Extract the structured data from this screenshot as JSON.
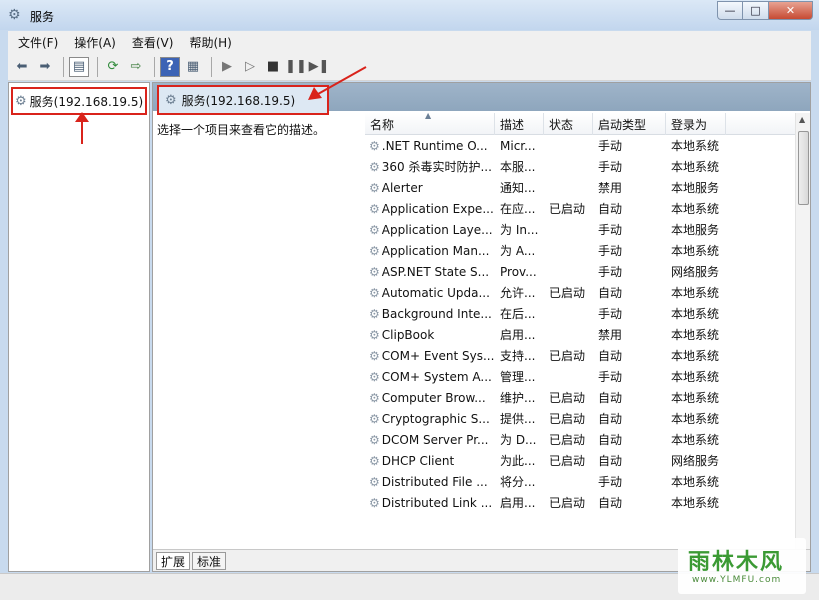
{
  "window": {
    "title": "服务",
    "controls": {
      "minimize": "—",
      "maximize": "□",
      "close": "✕"
    }
  },
  "menu": [
    "文件(F)",
    "操作(A)",
    "查看(V)",
    "帮助(H)"
  ],
  "toolbar_icons": [
    "back-arrow-icon",
    "forward-arrow-icon",
    "show-hide-tree-icon",
    "refresh-icon",
    "export-list-icon",
    "help-icon",
    "properties-pane-icon",
    "start-service-icon",
    "start-service-alt-icon",
    "stop-service-icon",
    "pause-service-icon",
    "restart-service-icon"
  ],
  "tree": {
    "node": "服务(192.168.19.5)"
  },
  "pane_header": "服务(192.168.19.5)",
  "description_hint": "选择一个项目来查看它的描述。",
  "columns": {
    "name": "名称",
    "desc": "描述",
    "status": "状态",
    "startup": "启动类型",
    "logon": "登录为"
  },
  "services": [
    {
      "name": ".NET Runtime O...",
      "desc": "Micr...",
      "status": "",
      "startup": "手动",
      "logon": "本地系统"
    },
    {
      "name": "360 杀毒实时防护...",
      "desc": "本服...",
      "status": "",
      "startup": "手动",
      "logon": "本地系统"
    },
    {
      "name": "Alerter",
      "desc": "通知...",
      "status": "",
      "startup": "禁用",
      "logon": "本地服务"
    },
    {
      "name": "Application Expe...",
      "desc": "在应...",
      "status": "已启动",
      "startup": "自动",
      "logon": "本地系统"
    },
    {
      "name": "Application Laye...",
      "desc": "为 In...",
      "status": "",
      "startup": "手动",
      "logon": "本地服务"
    },
    {
      "name": "Application Man...",
      "desc": "为 A...",
      "status": "",
      "startup": "手动",
      "logon": "本地系统"
    },
    {
      "name": "ASP.NET State S...",
      "desc": "Prov...",
      "status": "",
      "startup": "手动",
      "logon": "网络服务"
    },
    {
      "name": "Automatic Upda...",
      "desc": "允许...",
      "status": "已启动",
      "startup": "自动",
      "logon": "本地系统"
    },
    {
      "name": "Background Inte...",
      "desc": "在后...",
      "status": "",
      "startup": "手动",
      "logon": "本地系统"
    },
    {
      "name": "ClipBook",
      "desc": "启用...",
      "status": "",
      "startup": "禁用",
      "logon": "本地系统"
    },
    {
      "name": "COM+ Event Sys...",
      "desc": "支持...",
      "status": "已启动",
      "startup": "自动",
      "logon": "本地系统"
    },
    {
      "name": "COM+ System A...",
      "desc": "管理...",
      "status": "",
      "startup": "手动",
      "logon": "本地系统"
    },
    {
      "name": "Computer Brow...",
      "desc": "维护...",
      "status": "已启动",
      "startup": "自动",
      "logon": "本地系统"
    },
    {
      "name": "Cryptographic S...",
      "desc": "提供...",
      "status": "已启动",
      "startup": "自动",
      "logon": "本地系统"
    },
    {
      "name": "DCOM Server Pr...",
      "desc": "为 D...",
      "status": "已启动",
      "startup": "自动",
      "logon": "本地系统"
    },
    {
      "name": "DHCP Client",
      "desc": "为此...",
      "status": "已启动",
      "startup": "自动",
      "logon": "网络服务"
    },
    {
      "name": "Distributed File ...",
      "desc": "将分...",
      "status": "",
      "startup": "手动",
      "logon": "本地系统"
    },
    {
      "name": "Distributed Link ...",
      "desc": "启用...",
      "status": "已启动",
      "startup": "自动",
      "logon": "本地系统"
    }
  ],
  "tabs": [
    "扩展",
    "标准"
  ],
  "watermark": {
    "main": "雨林木风",
    "sub": "www.YLMFU.com"
  },
  "colors": {
    "highlight_box": "#d9231b",
    "header_band": "#9fb4c9"
  }
}
